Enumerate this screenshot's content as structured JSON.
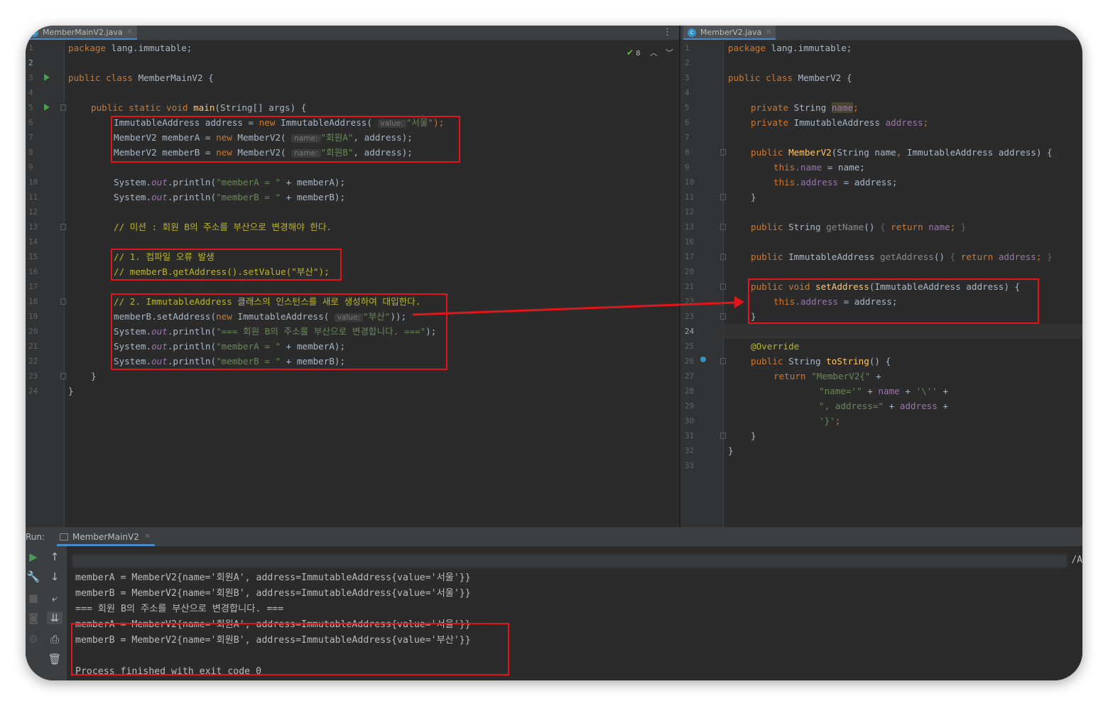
{
  "left_editor": {
    "tab_label": "MemberMainV2.java",
    "more_icon": "vertical-ellipsis-icon",
    "inspection": {
      "count": "8",
      "icon": "check-icon"
    },
    "lines": [
      {
        "num": "1"
      },
      {
        "num": "2"
      },
      {
        "num": "3"
      },
      {
        "num": "4"
      },
      {
        "num": "5"
      },
      {
        "num": "6"
      },
      {
        "num": "7"
      },
      {
        "num": "8"
      },
      {
        "num": "9"
      },
      {
        "num": "10"
      },
      {
        "num": "11"
      },
      {
        "num": "12"
      },
      {
        "num": "13"
      },
      {
        "num": "14"
      },
      {
        "num": "15"
      },
      {
        "num": "16"
      },
      {
        "num": "17"
      },
      {
        "num": "18"
      },
      {
        "num": "19"
      },
      {
        "num": "20"
      },
      {
        "num": "21"
      },
      {
        "num": "22"
      },
      {
        "num": "23"
      },
      {
        "num": "24"
      }
    ],
    "code": {
      "l1_kw": "package",
      "l1_rest": " lang.immutable;",
      "l3_kw": "public class",
      "l3_rest": " MemberMainV2 {",
      "l5_kw": "public static void",
      "l5_m": "main",
      "l5_rest": "(String[] args) {",
      "l6_a": "ImmutableAddress address = ",
      "l6_new": "new",
      "l6_b": " ImmutableAddress(",
      "l6_hint": "value:",
      "l6_s": "\"서울\"",
      "l6_end": ");",
      "l7_a": "MemberV2 memberA = ",
      "l7_new": "new",
      "l7_b": " MemberV2(",
      "l7_hint": "name:",
      "l7_s": "\"회원A\"",
      "l7_end": ", address);",
      "l8_a": "MemberV2 memberB = ",
      "l8_new": "new",
      "l8_b": " MemberV2(",
      "l8_hint": "name:",
      "l8_s": "\"회원B\"",
      "l8_end": ", address);",
      "l10_a": "System.",
      "l10_out": "out",
      "l10_b": ".println(",
      "l10_s": "\"memberA = \"",
      "l10_c": " + memberA);",
      "l11_a": "System.",
      "l11_out": "out",
      "l11_b": ".println(",
      "l11_s": "\"memberB = \"",
      "l11_c": " + memberB);",
      "l13": "// 미션 : 회원 B의 주소를 부산으로 변경해야 한다.",
      "l15": "// 1. 컴파일 오류 발생",
      "l16": "// memberB.getAddress().setValue(\"부산\");",
      "l18": "// 2. ImmutableAddress 클래스의 인스턴스를 새로 생성하여 대입한다.",
      "l19_a": "memberB.setAddress(",
      "l19_new": "new",
      "l19_b": " ImmutableAddress(",
      "l19_hint": "value:",
      "l19_s": "\"부산\"",
      "l19_end": "));",
      "l20_a": "System.",
      "l20_out": "out",
      "l20_b": ".println(",
      "l20_s": "\"=== 회원 B의 주소를 부산으로 변경합니다. ===\"",
      "l20_end": ");",
      "l21_a": "System.",
      "l21_out": "out",
      "l21_b": ".println(",
      "l21_s": "\"memberA = \"",
      "l21_c": " + memberA);",
      "l22_a": "System.",
      "l22_out": "out",
      "l22_b": ".println(",
      "l22_s": "\"memberB = \"",
      "l22_c": " + memberB);",
      "l23": "}",
      "l24": "}"
    }
  },
  "right_editor": {
    "tab_label": "MemberV2.java",
    "lines": [
      {
        "num": "1"
      },
      {
        "num": "2"
      },
      {
        "num": "3"
      },
      {
        "num": "4"
      },
      {
        "num": "5"
      },
      {
        "num": "6"
      },
      {
        "num": "7"
      },
      {
        "num": "8"
      },
      {
        "num": "9"
      },
      {
        "num": "10"
      },
      {
        "num": "11"
      },
      {
        "num": "12"
      },
      {
        "num": "13"
      },
      {
        "num": "16"
      },
      {
        "num": "17"
      },
      {
        "num": "20"
      },
      {
        "num": "21"
      },
      {
        "num": "22"
      },
      {
        "num": "23"
      },
      {
        "num": "24"
      },
      {
        "num": "25"
      },
      {
        "num": "26"
      },
      {
        "num": "27"
      },
      {
        "num": "28"
      },
      {
        "num": "29"
      },
      {
        "num": "30"
      },
      {
        "num": "31"
      },
      {
        "num": "32"
      },
      {
        "num": "33"
      }
    ],
    "code": {
      "r1_kw": "package",
      "r1_rest": " lang.immutable;",
      "r3_kw": "public class",
      "r3_rest": " MemberV2 {",
      "r5_kw": "private",
      "r5_t": " String ",
      "r5_f": "name",
      "r5_end": ";",
      "r6_kw": "private",
      "r6_t": " ImmutableAddress ",
      "r6_f": "address",
      "r6_end": ";",
      "r8_kw": "public",
      "r8_m": " MemberV2",
      "r8_a": "(String name",
      "r8_comma": ",",
      "r8_b": " ImmutableAddress address) {",
      "r9_this": "this",
      "r9_f": ".name",
      "r9_rest": " = name;",
      "r10_this": "this",
      "r10_f": ".address",
      "r10_rest": " = address;",
      "r11": "}",
      "r13_kw": "public",
      "r13_t": " String ",
      "r13_m": "getName",
      "r13_p": "() ",
      "r13_lb": "{ ",
      "r13_ret": "return",
      "r13_f": " name",
      "r13_semi": "; ",
      "r13_rb": "}",
      "r17_kw": "public",
      "r17_t": " ImmutableAddress ",
      "r17_m": "getAddress",
      "r17_p": "() ",
      "r17_lb": "{ ",
      "r17_ret": "return",
      "r17_f": " address",
      "r17_semi": "; ",
      "r17_rb": "}",
      "r21_kw": "public void",
      "r21_m": " setAddress",
      "r21_rest": "(ImmutableAddress address) {",
      "r22_this": "this",
      "r22_f": ".address",
      "r22_rest": " = address;",
      "r23": "}",
      "r25": "@Override",
      "r26_kw": "public",
      "r26_t": " String ",
      "r26_m": "toString",
      "r26_rest": "() {",
      "r27_ret": "return",
      "r27_s": " \"MemberV2{\"",
      "r27_rest": " +",
      "r28_s": "\"name='\"",
      "r28_a": " + ",
      "r28_f": "name",
      "r28_b": " + ",
      "r28_c": "'\\''",
      "r28_d": " +",
      "r29_s": "\", address=\"",
      "r29_a": " + ",
      "r29_f": "address",
      "r29_b": " +",
      "r30_s": "'}'",
      "r30_end": ";",
      "r31": "}",
      "r32": "}"
    }
  },
  "run_panel": {
    "label": "Run:",
    "tab_label": "MemberMainV2",
    "command_tail": "/A",
    "toolbar_icons": [
      "run-icon",
      "up-arrow-icon",
      "wrench-icon",
      "down-arrow-icon",
      "stop-icon",
      "soft-wrap-icon",
      "camera-icon",
      "scroll-to-end-icon",
      "gear-icon",
      "print-icon",
      "trash-icon"
    ],
    "output": [
      "memberA = MemberV2{name='회원A', address=ImmutableAddress{value='서울'}}",
      "memberB = MemberV2{name='회원B', address=ImmutableAddress{value='서울'}}",
      "=== 회원 B의 주소를 부산으로 변경합니다. ===",
      "memberA = MemberV2{name='회원A', address=ImmutableAddress{value='서울'}}",
      "memberB = MemberV2{name='회원B', address=ImmutableAddress{value='부산'}}",
      "",
      "Process finished with exit code 0"
    ]
  },
  "colors": {
    "annotation_red": "#e0161b",
    "keyword": "#cc7832",
    "string": "#6a8759",
    "field": "#9876aa",
    "method": "#ffc66d",
    "background": "#2b2b2b"
  }
}
